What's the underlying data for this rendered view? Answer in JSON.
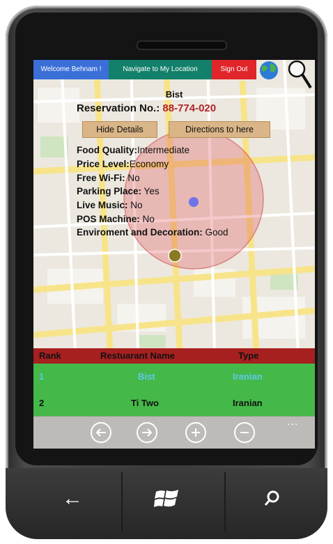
{
  "topbar": {
    "welcome_label": "Welcome Behnam !",
    "navigate_label": "Navigate to My Location",
    "signout_label": "Sign Out",
    "globe_icon": "globe-icon",
    "search_icon": "magnifier-icon"
  },
  "details": {
    "restaurant_name": "Bist",
    "reservation_label": "Reservation No.:",
    "reservation_number": "88-774-020",
    "hide_details_label": "Hide Details",
    "directions_label": "Directions to here",
    "rows": [
      {
        "label": "Food Quality:",
        "value": "Intermediate"
      },
      {
        "label": "Price Level:",
        "value": "Economy"
      },
      {
        "label": "Free Wi-Fi:",
        "value": " No"
      },
      {
        "label": "Parking Place:",
        "value": " Yes"
      },
      {
        "label": "Live Music:",
        "value": " No"
      },
      {
        "label": "POS Machine:",
        "value": " No"
      },
      {
        "label": "Enviroment and Decoration:",
        "value": " Good"
      }
    ]
  },
  "table": {
    "headers": {
      "rank": "Rank",
      "name": "Restuarant Name",
      "type": "Type"
    },
    "rows": [
      {
        "rank": "1",
        "name": "Bist",
        "type": "Iranian"
      },
      {
        "rank": "2",
        "name": "Ti Two",
        "type": "Iranian"
      }
    ]
  },
  "appbar": {
    "icons": [
      "back-arrow-icon",
      "forward-arrow-icon",
      "zoom-in-icon",
      "zoom-out-icon"
    ],
    "more": "..."
  },
  "hardware": {
    "back": "←",
    "search": "⚲"
  },
  "colors": {
    "welcome": "#3b6fd8",
    "navigate": "#12806a",
    "signout": "#e0252b",
    "reservation": "#b0242a",
    "button_fill": "#d9b588",
    "table_head": "#a62020",
    "table_body": "#2aa82a",
    "selected_text": "#5ec9e8"
  }
}
